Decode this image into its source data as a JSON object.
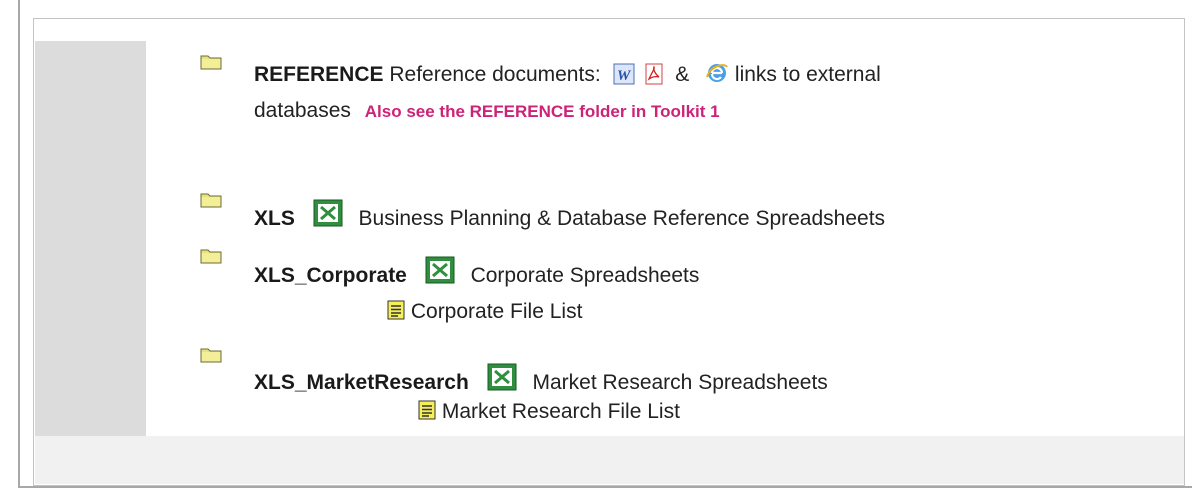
{
  "reference": {
    "name": "REFERENCE",
    "desc_prefix": "Reference documents:",
    "amp": "&",
    "desc_suffix": "links to external",
    "desc_line2": "databases",
    "note": "Also see the REFERENCE folder in Toolkit 1"
  },
  "xls": {
    "name": "XLS",
    "desc": "Business Planning & Database Reference Spreadsheets"
  },
  "xls_corporate": {
    "name": "XLS_Corporate",
    "desc": "Corporate Spreadsheets",
    "file_list": "Corporate File List"
  },
  "xls_market": {
    "name": "XLS_MarketResearch",
    "desc": "Market Research Spreadsheets",
    "file_list": "Market Research File List"
  },
  "colors": {
    "note": "#cc2277",
    "gutter": "#dcdcdc",
    "footer": "#f1f1f1"
  },
  "icons": [
    "folder-icon",
    "word-icon",
    "pdf-icon",
    "ie-icon",
    "excel-icon",
    "document-icon"
  ]
}
